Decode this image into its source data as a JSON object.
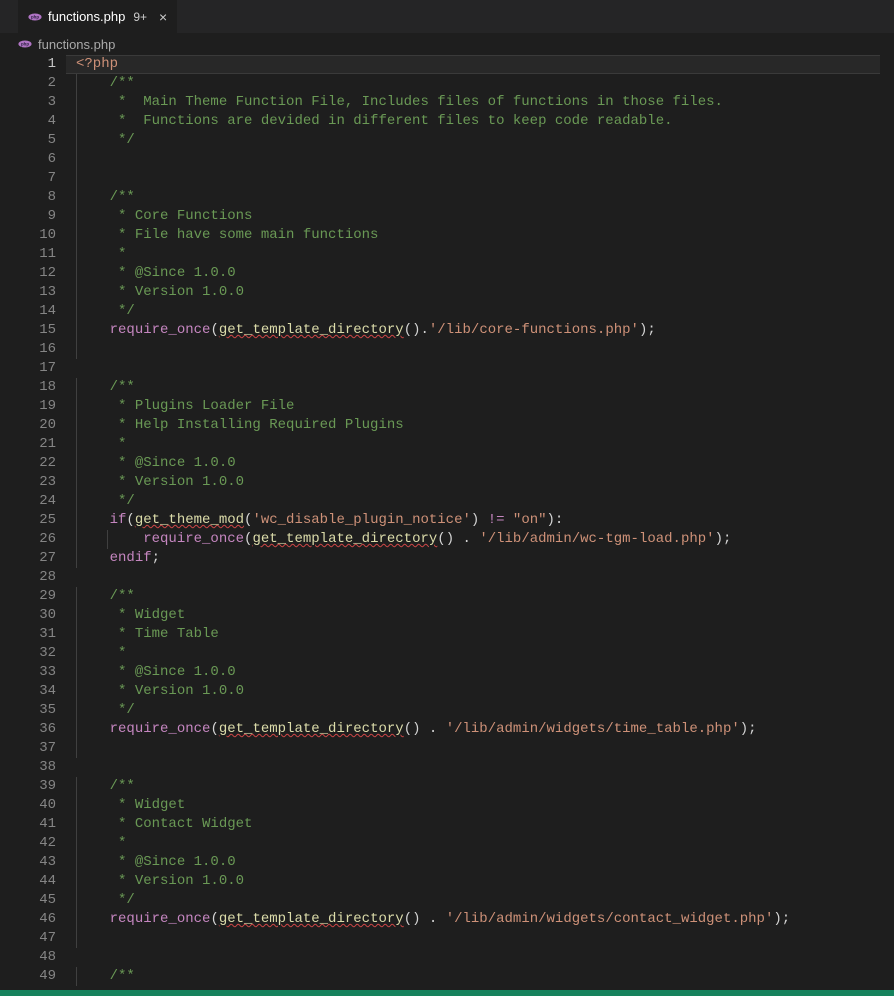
{
  "tab": {
    "label": "functions.php",
    "dirty_indicator": "9+",
    "close_glyph": "×"
  },
  "breadcrumb": {
    "label": "functions.php"
  },
  "active_line": 1,
  "icons": {
    "php": "php-icon",
    "close": "close-icon"
  },
  "colors": {
    "background": "#1e1e1e",
    "tabbar": "#252526",
    "statusbar": "#16825d",
    "line_number": "#858585",
    "active_line_number": "#c6c6c6",
    "comment": "#6a9955",
    "keyword": "#c586c0",
    "function": "#dcdcaa",
    "string": "#ce9178",
    "punctuation": "#d4d4d4"
  },
  "code_lines": [
    {
      "n": 1,
      "tokens": [
        {
          "t": "<?php",
          "c": "phptag"
        }
      ]
    },
    {
      "n": 2,
      "indent": 1,
      "tokens": [
        {
          "t": "/**",
          "c": "comment"
        }
      ]
    },
    {
      "n": 3,
      "indent": 1,
      "tokens": [
        {
          "t": " *  Main Theme Function File, Includes files of functions in those files.",
          "c": "comment"
        }
      ]
    },
    {
      "n": 4,
      "indent": 1,
      "tokens": [
        {
          "t": " *  Functions are devided in different files to keep code readable.",
          "c": "comment"
        }
      ]
    },
    {
      "n": 5,
      "indent": 1,
      "tokens": [
        {
          "t": " */",
          "c": "comment"
        }
      ]
    },
    {
      "n": 6,
      "indent": 1,
      "tokens": []
    },
    {
      "n": 7,
      "indent": 1,
      "tokens": []
    },
    {
      "n": 8,
      "indent": 1,
      "tokens": [
        {
          "t": "/**",
          "c": "comment"
        }
      ]
    },
    {
      "n": 9,
      "indent": 1,
      "tokens": [
        {
          "t": " * Core Functions",
          "c": "comment"
        }
      ]
    },
    {
      "n": 10,
      "indent": 1,
      "tokens": [
        {
          "t": " * File have some main functions",
          "c": "comment"
        }
      ]
    },
    {
      "n": 11,
      "indent": 1,
      "tokens": [
        {
          "t": " *",
          "c": "comment"
        }
      ]
    },
    {
      "n": 12,
      "indent": 1,
      "tokens": [
        {
          "t": " * @Since 1.0.0",
          "c": "comment"
        }
      ]
    },
    {
      "n": 13,
      "indent": 1,
      "tokens": [
        {
          "t": " * Version 1.0.0",
          "c": "comment"
        }
      ]
    },
    {
      "n": 14,
      "indent": 1,
      "tokens": [
        {
          "t": " */",
          "c": "comment"
        }
      ]
    },
    {
      "n": 15,
      "indent": 1,
      "tokens": [
        {
          "t": "require_once",
          "c": "keyword"
        },
        {
          "t": "(",
          "c": "punct"
        },
        {
          "t": "get_template_directory",
          "c": "func",
          "wavy": true
        },
        {
          "t": "()",
          "c": "punct"
        },
        {
          "t": ".",
          "c": "punct"
        },
        {
          "t": "'/lib/core-functions.php'",
          "c": "string"
        },
        {
          "t": ");",
          "c": "punct"
        }
      ]
    },
    {
      "n": 16,
      "indent": 1,
      "tokens": []
    },
    {
      "n": 17,
      "indent": 0,
      "tokens": []
    },
    {
      "n": 18,
      "indent": 1,
      "tokens": [
        {
          "t": "/**",
          "c": "comment"
        }
      ]
    },
    {
      "n": 19,
      "indent": 1,
      "tokens": [
        {
          "t": " * Plugins Loader File",
          "c": "comment"
        }
      ]
    },
    {
      "n": 20,
      "indent": 1,
      "tokens": [
        {
          "t": " * Help Installing Required Plugins",
          "c": "comment"
        }
      ]
    },
    {
      "n": 21,
      "indent": 1,
      "tokens": [
        {
          "t": " *",
          "c": "comment"
        }
      ]
    },
    {
      "n": 22,
      "indent": 1,
      "tokens": [
        {
          "t": " * @Since 1.0.0",
          "c": "comment"
        }
      ]
    },
    {
      "n": 23,
      "indent": 1,
      "tokens": [
        {
          "t": " * Version 1.0.0",
          "c": "comment"
        }
      ]
    },
    {
      "n": 24,
      "indent": 1,
      "tokens": [
        {
          "t": " */",
          "c": "comment"
        }
      ]
    },
    {
      "n": 25,
      "indent": 1,
      "tokens": [
        {
          "t": "if",
          "c": "keyword"
        },
        {
          "t": "(",
          "c": "punct"
        },
        {
          "t": "get_theme_mod",
          "c": "func",
          "wavy": true
        },
        {
          "t": "(",
          "c": "punct"
        },
        {
          "t": "'wc_disable_plugin_notice'",
          "c": "string"
        },
        {
          "t": ") ",
          "c": "punct"
        },
        {
          "t": "!=",
          "c": "keyword"
        },
        {
          "t": " ",
          "c": "punct"
        },
        {
          "t": "\"on\"",
          "c": "string"
        },
        {
          "t": "):",
          "c": "punct"
        }
      ]
    },
    {
      "n": 26,
      "indent": 2,
      "tokens": [
        {
          "t": "require_once",
          "c": "keyword"
        },
        {
          "t": "(",
          "c": "punct"
        },
        {
          "t": "get_template_directory",
          "c": "func",
          "wavy": true
        },
        {
          "t": "() . ",
          "c": "punct"
        },
        {
          "t": "'/lib/admin/wc-tgm-load.php'",
          "c": "string"
        },
        {
          "t": ");",
          "c": "punct"
        }
      ]
    },
    {
      "n": 27,
      "indent": 1,
      "tokens": [
        {
          "t": "endif",
          "c": "keyword"
        },
        {
          "t": ";",
          "c": "punct"
        }
      ]
    },
    {
      "n": 28,
      "indent": 0,
      "tokens": []
    },
    {
      "n": 29,
      "indent": 1,
      "tokens": [
        {
          "t": "/**",
          "c": "comment"
        }
      ]
    },
    {
      "n": 30,
      "indent": 1,
      "tokens": [
        {
          "t": " * Widget",
          "c": "comment"
        }
      ]
    },
    {
      "n": 31,
      "indent": 1,
      "tokens": [
        {
          "t": " * Time Table",
          "c": "comment"
        }
      ]
    },
    {
      "n": 32,
      "indent": 1,
      "tokens": [
        {
          "t": " *",
          "c": "comment"
        }
      ]
    },
    {
      "n": 33,
      "indent": 1,
      "tokens": [
        {
          "t": " * @Since 1.0.0",
          "c": "comment"
        }
      ]
    },
    {
      "n": 34,
      "indent": 1,
      "tokens": [
        {
          "t": " * Version 1.0.0",
          "c": "comment"
        }
      ]
    },
    {
      "n": 35,
      "indent": 1,
      "tokens": [
        {
          "t": " */",
          "c": "comment"
        }
      ]
    },
    {
      "n": 36,
      "indent": 1,
      "tokens": [
        {
          "t": "require_once",
          "c": "keyword"
        },
        {
          "t": "(",
          "c": "punct"
        },
        {
          "t": "get_template_directory",
          "c": "func",
          "wavy": true
        },
        {
          "t": "() . ",
          "c": "punct"
        },
        {
          "t": "'/lib/admin/widgets/time_table.php'",
          "c": "string"
        },
        {
          "t": ");",
          "c": "punct"
        }
      ]
    },
    {
      "n": 37,
      "indent": 1,
      "tokens": []
    },
    {
      "n": 38,
      "indent": 0,
      "tokens": []
    },
    {
      "n": 39,
      "indent": 1,
      "tokens": [
        {
          "t": "/**",
          "c": "comment"
        }
      ]
    },
    {
      "n": 40,
      "indent": 1,
      "tokens": [
        {
          "t": " * Widget",
          "c": "comment"
        }
      ]
    },
    {
      "n": 41,
      "indent": 1,
      "tokens": [
        {
          "t": " * Contact Widget",
          "c": "comment"
        }
      ]
    },
    {
      "n": 42,
      "indent": 1,
      "tokens": [
        {
          "t": " *",
          "c": "comment"
        }
      ]
    },
    {
      "n": 43,
      "indent": 1,
      "tokens": [
        {
          "t": " * @Since 1.0.0",
          "c": "comment"
        }
      ]
    },
    {
      "n": 44,
      "indent": 1,
      "tokens": [
        {
          "t": " * Version 1.0.0",
          "c": "comment"
        }
      ]
    },
    {
      "n": 45,
      "indent": 1,
      "tokens": [
        {
          "t": " */",
          "c": "comment"
        }
      ]
    },
    {
      "n": 46,
      "indent": 1,
      "tokens": [
        {
          "t": "require_once",
          "c": "keyword"
        },
        {
          "t": "(",
          "c": "punct"
        },
        {
          "t": "get_template_directory",
          "c": "func",
          "wavy": true
        },
        {
          "t": "() . ",
          "c": "punct"
        },
        {
          "t": "'/lib/admin/widgets/contact_widget.php'",
          "c": "string"
        },
        {
          "t": ");",
          "c": "punct"
        }
      ]
    },
    {
      "n": 47,
      "indent": 1,
      "tokens": []
    },
    {
      "n": 48,
      "indent": 0,
      "tokens": []
    },
    {
      "n": 49,
      "indent": 1,
      "tokens": [
        {
          "t": "/**",
          "c": "comment"
        }
      ]
    }
  ]
}
